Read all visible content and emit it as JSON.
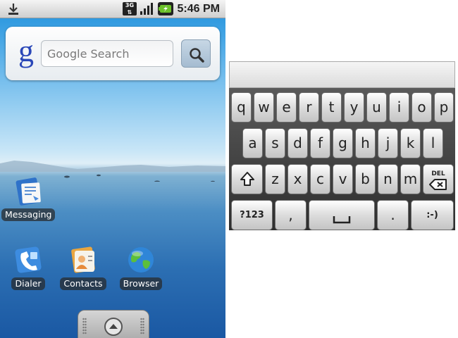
{
  "status_bar": {
    "network": "3G",
    "time": "5:46 PM",
    "icons": [
      "download-icon",
      "3g-icon",
      "signal-icon",
      "battery-charging-icon"
    ]
  },
  "search_widget": {
    "logo": "g",
    "placeholder": "Google Search",
    "button_icon": "magnifier-icon"
  },
  "apps": {
    "messaging": "Messaging",
    "dialer": "Dialer",
    "contacts": "Contacts",
    "browser": "Browser"
  },
  "launcher": {
    "icon": "chevron-up-icon"
  },
  "keyboard": {
    "row1": [
      "q",
      "w",
      "e",
      "r",
      "t",
      "y",
      "u",
      "i",
      "o",
      "p"
    ],
    "row2": [
      "a",
      "s",
      "d",
      "f",
      "g",
      "h",
      "j",
      "k",
      "l"
    ],
    "row3": [
      "z",
      "x",
      "c",
      "v",
      "b",
      "n",
      "m"
    ],
    "shift_icon": "shift-arrow-icon",
    "del_label": "DEL",
    "symbols_label": "?123",
    "comma_label": ",",
    "period_label": ".",
    "smiley_label": ":-)",
    "space_icon": "space-bar-icon"
  }
}
